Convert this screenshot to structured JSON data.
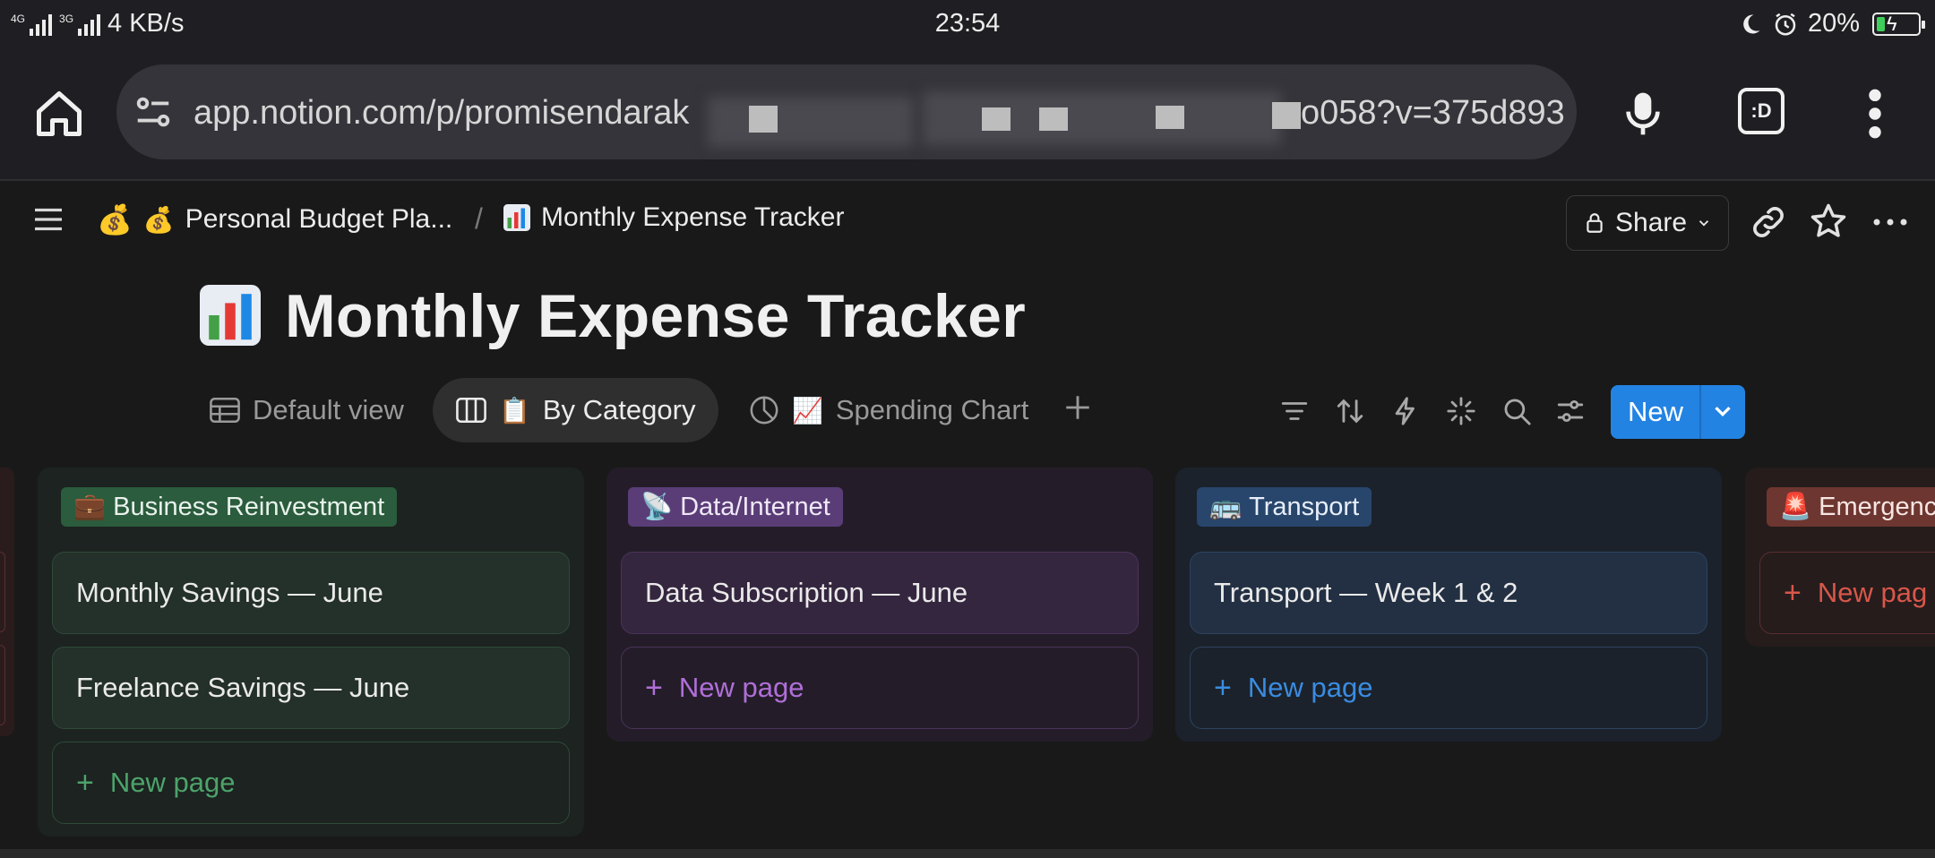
{
  "status_bar": {
    "network": "4G",
    "network2": "3G",
    "speed": "4 KB/s",
    "time": "23:54",
    "battery": "20%",
    "battery_level": 0.2
  },
  "browser": {
    "url_start": "app.notion.com/p/promisendarak",
    "url_end": "o058?v=375d893",
    "tabs_label": ":D"
  },
  "breadcrumb": {
    "parent": "Personal Budget Pla...",
    "separator": "/",
    "current": "Monthly Expense Tracker"
  },
  "header": {
    "share_label": "Share"
  },
  "page": {
    "title": "Monthly Expense Tracker"
  },
  "views": {
    "tabs": [
      {
        "label": "Default view",
        "icon": "table-icon"
      },
      {
        "label": "By Category",
        "icon": "board-icon",
        "emoji": "📋"
      },
      {
        "label": "Spending Chart",
        "icon": "chart-icon",
        "emoji": "📈"
      }
    ],
    "new_label": "New"
  },
  "board": {
    "columns": [
      {
        "tag": "Business Reinvestment",
        "emoji": "💼",
        "cards": [
          "Monthly Savings — June",
          "Freelance Savings — June"
        ],
        "new_label": "New page"
      },
      {
        "tag": "Data/Internet",
        "emoji": "📡",
        "cards": [
          "Data Subscription — June"
        ],
        "new_label": "New page"
      },
      {
        "tag": "Transport",
        "emoji": "🚌",
        "cards": [
          "Transport — Week 1 & 2"
        ],
        "new_label": "New page"
      },
      {
        "tag": "Emergenc",
        "emoji": "🚨",
        "cards": [],
        "new_label": "New pag"
      }
    ]
  },
  "colors": {
    "accent": "#2383e2",
    "green_tag": "#2b5c3d",
    "purple_tag": "#5a3d77",
    "blue_tag": "#28456c",
    "red_tag": "#6e3630"
  }
}
